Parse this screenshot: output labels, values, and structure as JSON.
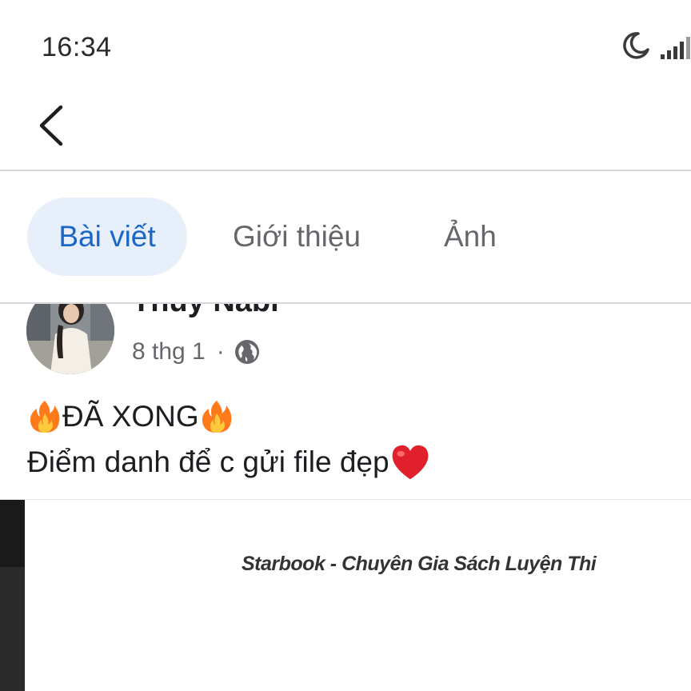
{
  "status_bar": {
    "time": "16:34",
    "icons": [
      "moon-icon",
      "signal-icon"
    ]
  },
  "nav": {
    "back_icon": "chevron-left-icon"
  },
  "tabs": [
    {
      "label": "Bài viết",
      "active": true
    },
    {
      "label": "Giới thiệu",
      "active": false
    },
    {
      "label": "Ảnh",
      "active": false
    }
  ],
  "post": {
    "author": "Thủy Nabi",
    "date": "8 thg 1",
    "separator": "·",
    "privacy_icon": "globe-icon",
    "line1": "ĐÃ XONG",
    "line2": "Điểm danh để c gửi file đẹp",
    "emojis": [
      "fire-icon",
      "fire-icon",
      "heart-icon"
    ],
    "image_caption": "Starbook - Chuyên Gia Sách Luyện Thi"
  },
  "colors": {
    "accent": "#1b66c7",
    "active_tab_bg": "#e7f0fa",
    "muted_text": "#65676b",
    "heart": "#e0202a",
    "fire": "#ff7a1a"
  }
}
